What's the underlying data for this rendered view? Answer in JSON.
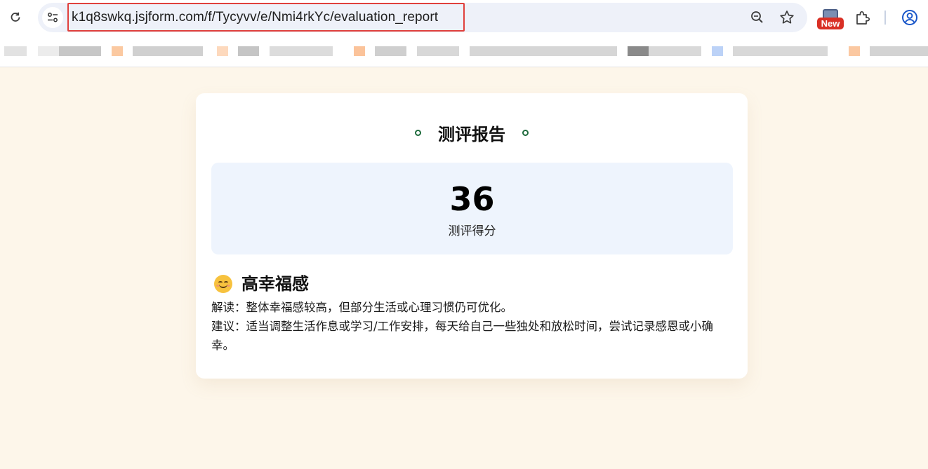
{
  "browser": {
    "url": "k1q8swkq.jsjform.com/f/Tycyvv/e/Nmi4rkYc/evaluation_report",
    "icons": {
      "reload": "reload-icon",
      "site_info": "site-info-icon",
      "zoom": "zoom-icon",
      "bookmark": "star-icon",
      "extension_badge": "New",
      "extensions": "puzzle-icon",
      "profile": "profile-icon"
    },
    "colors": {
      "highlight_border": "#e0403c",
      "omnibox": "#eef1f9",
      "badge": "#d93025"
    }
  },
  "report": {
    "title": "测评报告",
    "score": "36",
    "score_label": "测评得分",
    "level_icon": "smile-emoji-icon",
    "level": "高幸福感",
    "interpretation": "解读：整体幸福感较高，但部分生活或心理习惯仍可优化。",
    "suggestion": "建议：适当调整生活作息或学习/工作安排，每天给自己一些独处和放松时间，尝试记录感恩或小确幸。"
  },
  "colors": {
    "page_bg": "#fdf6ea",
    "card_bg": "#ffffff",
    "score_bg": "#eef4fd",
    "title_dots": "#1f6b3d"
  }
}
